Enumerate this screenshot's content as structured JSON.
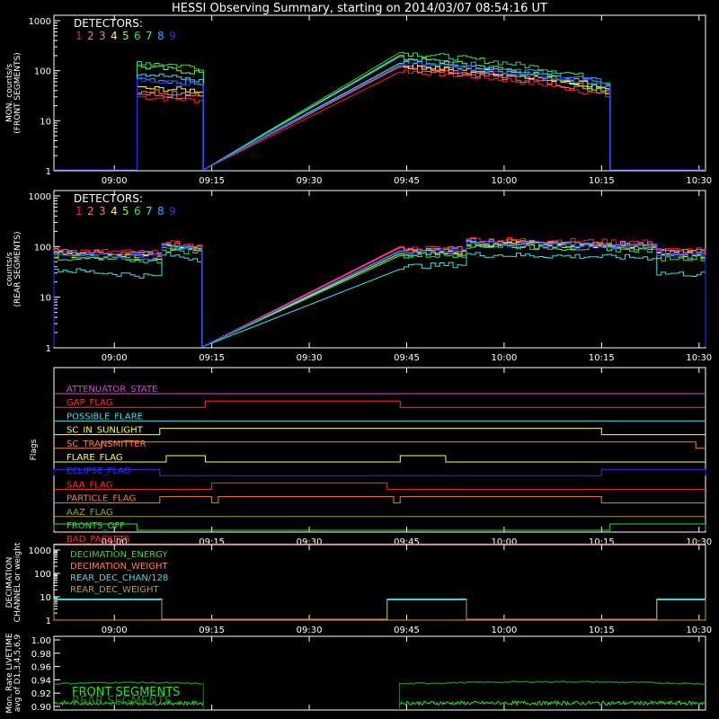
{
  "title": "HESSI Observing Summary, starting on 2014/03/07 08:54:16 UT",
  "colors": {
    "background": "#000000",
    "axis": "#ffffff",
    "det": [
      "#ff2020",
      "#ff60a0",
      "#ff8040",
      "#ffff40",
      "#70ff50",
      "#30e050",
      "#40e0e0",
      "#40a0ff",
      "#3030ff"
    ]
  },
  "time_axis": {
    "start_min": -4.3,
    "end_min": 96.0,
    "ticks": [
      {
        "min": 5,
        "label": "09:00"
      },
      {
        "min": 20,
        "label": "09:15"
      },
      {
        "min": 35,
        "label": "09:30"
      },
      {
        "min": 50,
        "label": "09:45"
      },
      {
        "min": 65,
        "label": "10:00"
      },
      {
        "min": 80,
        "label": "10:15"
      },
      {
        "min": 95,
        "label": "10:30"
      }
    ]
  },
  "chart_data": [
    {
      "type": "line",
      "panel": "front",
      "ylabel": "MON. counts/s (FRONT SEGMENTS)",
      "yscale": "log",
      "ylim": [
        1,
        1000
      ],
      "yticks": [
        "1",
        "10",
        "100",
        "1000"
      ],
      "legend": {
        "title": "DETECTORS:",
        "items": [
          "1",
          "2",
          "3",
          "4",
          "5",
          "6",
          "7",
          "8",
          "9"
        ]
      },
      "segments": [
        {
          "start_min": 8.5,
          "end_min": 18.7,
          "start": [
            30,
            34,
            40,
            45,
            120,
            150,
            90,
            70,
            65
          ],
          "end": [
            25,
            28,
            35,
            40,
            90,
            115,
            60,
            55,
            50
          ]
        },
        {
          "start_min": 48.9,
          "end_min": 81.3,
          "start": [
            100,
            110,
            120,
            130,
            180,
            230,
            150,
            170,
            140
          ],
          "end": [
            30,
            35,
            40,
            45,
            30,
            55,
            45,
            55,
            50
          ]
        }
      ]
    },
    {
      "type": "line",
      "panel": "rear",
      "ylabel": "counts/s (REAR SEGMENTS)",
      "yscale": "log",
      "ylim": [
        1,
        1000
      ],
      "yticks": [
        "1",
        "10",
        "100",
        "1000"
      ],
      "legend": {
        "title": "DETECTORS:",
        "items": [
          "1",
          "2",
          "3",
          "4",
          "5",
          "6",
          "7",
          "8",
          "9"
        ]
      },
      "segments": [
        {
          "start_min": -4.3,
          "end_min": 12.3,
          "start": [
            85,
            80,
            75,
            70,
            65,
            60,
            35,
            75,
            70
          ],
          "end": [
            75,
            70,
            65,
            62,
            58,
            52,
            25,
            68,
            62
          ]
        },
        {
          "start_min": 12.3,
          "end_min": 18.5,
          "start": [
            120,
            115,
            105,
            100,
            95,
            90,
            70,
            110,
            100
          ],
          "end": [
            100,
            95,
            90,
            85,
            80,
            75,
            55,
            90,
            85
          ]
        },
        {
          "start_min": 48.9,
          "end_min": 59.2,
          "start": [
            90,
            85,
            80,
            75,
            70,
            65,
            40,
            80,
            75
          ],
          "end": [
            95,
            90,
            85,
            80,
            75,
            70,
            45,
            85,
            80
          ]
        },
        {
          "start_min": 59.2,
          "end_min": 88.5,
          "start": [
            140,
            130,
            120,
            115,
            110,
            105,
            70,
            125,
            115
          ],
          "end": [
            120,
            110,
            100,
            95,
            90,
            85,
            60,
            105,
            95
          ]
        },
        {
          "start_min": 88.5,
          "end_min": 96.0,
          "start": [
            85,
            80,
            75,
            70,
            65,
            60,
            30,
            75,
            70
          ],
          "end": [
            85,
            80,
            75,
            70,
            65,
            60,
            28,
            75,
            70
          ]
        }
      ]
    },
    {
      "type": "line",
      "panel": "flags",
      "ylabel": "Flags",
      "flags": [
        {
          "name": "ATTENUATOR_STATE",
          "color": "#e040e0",
          "highs": []
        },
        {
          "name": "GAP_FLAG",
          "color": "#ff3030",
          "highs": [
            [
              19.0,
              49.0
            ]
          ]
        },
        {
          "name": "POSSIBLE_FLARE",
          "color": "#40e0e0",
          "highs": []
        },
        {
          "name": "SC_IN_SUNLIGHT",
          "color": "#ffff40",
          "highs": [
            [
              12.0,
              80.0
            ]
          ]
        },
        {
          "name": "SC_TRANSMITTER",
          "color": "#ff8040",
          "highs": [
            [
              3.0,
              94.5
            ]
          ]
        },
        {
          "name": "FLARE_FLAG",
          "color": "#ffff40",
          "highs": [
            [
              13.0,
              19.0
            ],
            [
              49.0,
              56.0
            ]
          ]
        },
        {
          "name": "ECLIPSE_FLAG",
          "color": "#3030ff",
          "highs": [
            [
              -4.3,
              12.0
            ],
            [
              80.0,
              96.0
            ]
          ]
        },
        {
          "name": "SAA_FLAG",
          "color": "#ff3030",
          "highs": [
            [
              20.0,
              47.0
            ]
          ]
        },
        {
          "name": "PARTICLE_FLAG",
          "color": "#ff8020",
          "highs": [
            [
              12.0,
              20.0
            ],
            [
              21.0,
              48.0
            ],
            [
              49.0,
              80.0
            ]
          ]
        },
        {
          "name": "AAZ_FLAG",
          "color": "#a0a040",
          "highs": []
        },
        {
          "name": "FRONTS_OFF",
          "color": "#30e030",
          "highs": [
            [
              -4.3,
              8.5
            ],
            [
              81.3,
              96.0
            ]
          ]
        },
        {
          "name": "BAD_PACKETS",
          "color": "#ff3030",
          "highs": []
        }
      ]
    },
    {
      "type": "line",
      "panel": "decimation",
      "ylabel": "DECIMATION CHANNEL or weight",
      "yscale": "log",
      "ylim": [
        1,
        1000
      ],
      "yticks": [
        "1",
        "10",
        "100",
        "1000"
      ],
      "legend": {
        "items": [
          {
            "label": "DECIMATION_ENERGY",
            "color": "#30e030"
          },
          {
            "label": "DECIMATION_WEIGHT",
            "color": "#ff8040"
          },
          {
            "label": "REAR_DEC_CHAN/128",
            "color": "#40e0e0"
          },
          {
            "label": "REAR_DEC_WEIGHT",
            "color": "#b0a040"
          }
        ]
      },
      "high_intervals": [
        [
          -4.3,
          12.3
        ],
        [
          47.0,
          59.2
        ],
        [
          88.5,
          96.0
        ]
      ],
      "high_value": 8
    },
    {
      "type": "line",
      "panel": "livetime",
      "ylabel": "Mon. Rate LIVETIME avg of D1,3,4,5,6,9",
      "ylim": [
        0.9,
        1.0
      ],
      "yticks": [
        "0.90",
        "0.92",
        "0.94",
        "0.96",
        "0.98",
        "1.00"
      ],
      "legend": {
        "items": [
          {
            "label": "FRONT SEGMENTS",
            "color": "#30e030"
          },
          {
            "label": "REAR SEGMENTS",
            "color": "#208020"
          }
        ]
      },
      "rear_segments": [
        [
          -4.3,
          18.5,
          0.934,
          0.936
        ],
        [
          48.9,
          96.0,
          0.934,
          0.937
        ]
      ],
      "front_segments": [
        [
          -4.3,
          18.7,
          0.905
        ],
        [
          48.9,
          96.0,
          0.905
        ]
      ]
    }
  ]
}
